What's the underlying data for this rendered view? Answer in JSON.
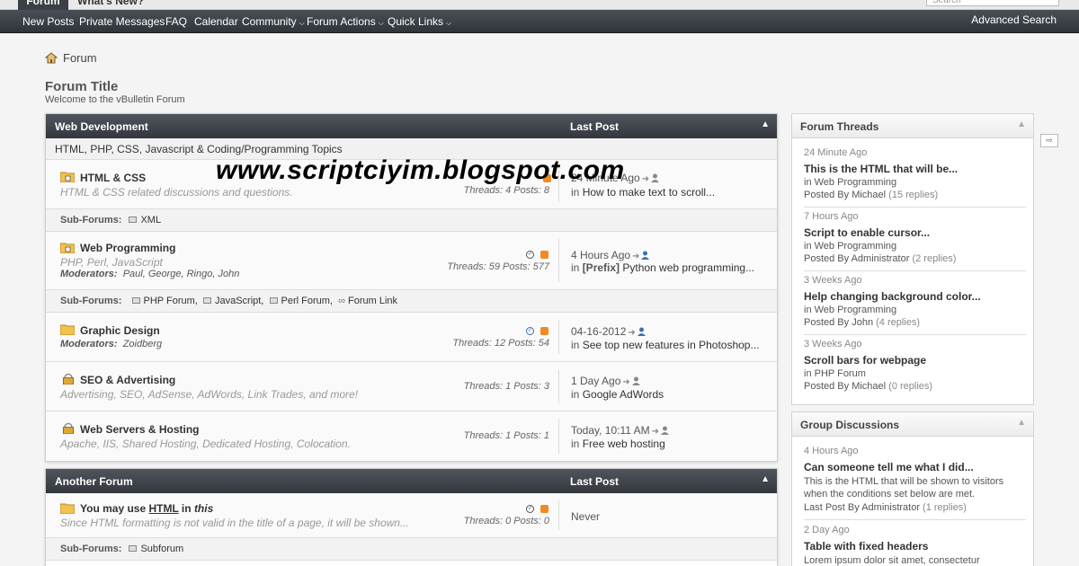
{
  "tabs": {
    "forum": "Forum",
    "whats_new": "What's New?"
  },
  "search_placeholder": "Search",
  "nav": [
    {
      "label": "New Posts",
      "has_menu": false
    },
    {
      "label": "Private Messages",
      "has_menu": false
    },
    {
      "label": "FAQ",
      "has_menu": false
    },
    {
      "label": "Calendar",
      "has_menu": false
    },
    {
      "label": "Community",
      "has_menu": true
    },
    {
      "label": "Forum Actions",
      "has_menu": true
    },
    {
      "label": "Quick Links",
      "has_menu": true
    }
  ],
  "advanced_search": "Advanced Search",
  "breadcrumb": "Forum",
  "page_title": "Forum Title",
  "page_desc": "Welcome to the vBulletin Forum",
  "watermark": "www.scriptciyim.blogspot.com",
  "block1": {
    "title": "Web Development",
    "last_post_label": "Last Post",
    "desc": "HTML, PHP, CSS, Javascript & Coding/Programming Topics",
    "forums": [
      {
        "name": "HTML & CSS",
        "desc": "HTML & CSS related discussions and questions.",
        "stats": "Threads: 4  Posts: 8",
        "last1": "24 Minute Ago",
        "last2_prefix": "in ",
        "last2": "How to make text to scroll...",
        "subforums_label": "Sub-Forums:",
        "subforums": "XML"
      },
      {
        "name": "Web Programming",
        "desc": "PHP, Perl, JavaScript",
        "mods_label": "Moderators:",
        "mods": "Paul, George, Ringo, John",
        "stats": "Threads: 59  Posts: 577",
        "last1": "4 Hours Ago",
        "last2_prefix": "in ",
        "last2_tag": "[Prefix]",
        "last2": " Python web programming...",
        "subforums_label": "Sub-Forums:",
        "subforums": [
          "PHP Forum,",
          "JavaScript,",
          "Perl Forum,",
          "Forum Link"
        ]
      },
      {
        "name": "Graphic Design",
        "mods_label": "Moderators:",
        "mods": "Zoidberg",
        "stats": "Threads: 12  Posts: 54",
        "last1": "04-16-2012",
        "last2_prefix": "in ",
        "last2": "See top new features in Photoshop..."
      },
      {
        "name": "SEO & Advertising",
        "desc": "Advertising, SEO, AdSense, AdWords, Link Trades, and more!",
        "stats": "Threads: 1  Posts: 3",
        "last1": "1 Day Ago",
        "last2_prefix": "in ",
        "last2": "Google AdWords"
      },
      {
        "name": "Web Servers & Hosting",
        "desc": "Apache, IIS, Shared Hosting, Dedicated Hosting, Colocation.",
        "stats": "Threads: 1  Posts: 1",
        "last1": "Today, 10:11 AM",
        "last2_prefix": "in ",
        "last2": "Free web hosting"
      }
    ]
  },
  "block2": {
    "title": "Another Forum",
    "last_post_label": "Last Post",
    "forum": {
      "name_a": "You may use ",
      "name_b": "HTML",
      "name_c": " in ",
      "name_d": "this",
      "desc": "Since HTML formatting is not valid in the title of a page, it will be shown...",
      "stats": "Threads: 0  Posts: 0",
      "last1": "Never",
      "subforums_label": "Sub-Forums:",
      "subforums": "Subforum"
    }
  },
  "threads": {
    "title": "Forum Threads",
    "items": [
      {
        "time": "24 Minute Ago",
        "title": "This is the HTML that will be...",
        "in_label": "in ",
        "forum": "Web Programming",
        "by_label": "Posted By ",
        "user": "Michael",
        "replies": " (15 replies)"
      },
      {
        "time": "7 Hours Ago",
        "title": "Script to enable cursor...",
        "in_label": "in ",
        "forum": "Web Programming",
        "by_label": "Posted By ",
        "user": "Administrator",
        "replies": " (2 replies)"
      },
      {
        "time": "3 Weeks Ago",
        "title": "Help changing background color...",
        "in_label": "in ",
        "forum": "Web Programming",
        "by_label": "Posted By ",
        "user": "John",
        "replies": " (4 replies)"
      },
      {
        "time": "3 Weeks Ago",
        "title": "Scroll bars for webpage",
        "in_label": "in ",
        "forum": "PHP Forum",
        "by_label": "Posted By ",
        "user": "Michael",
        "replies": " (0 replies)"
      }
    ]
  },
  "groups": {
    "title": "Group Discussions",
    "items": [
      {
        "time": "4 Hours Ago",
        "title": "Can someone tell me what I did...",
        "desc": "This is the HTML that will be shown to visitors when the conditions set below are met.",
        "by_label": "Last Post By ",
        "user": "Administrator",
        "replies": " (1 replies)"
      },
      {
        "time": "2 Day Ago",
        "title": "Table with fixed headers",
        "desc": "Lorem ipsum dolor sit amet, consectetur"
      }
    ]
  },
  "colors": {
    "header_dark": "#33373d",
    "rss": "#f08a24",
    "folder": "#f2c14e"
  }
}
